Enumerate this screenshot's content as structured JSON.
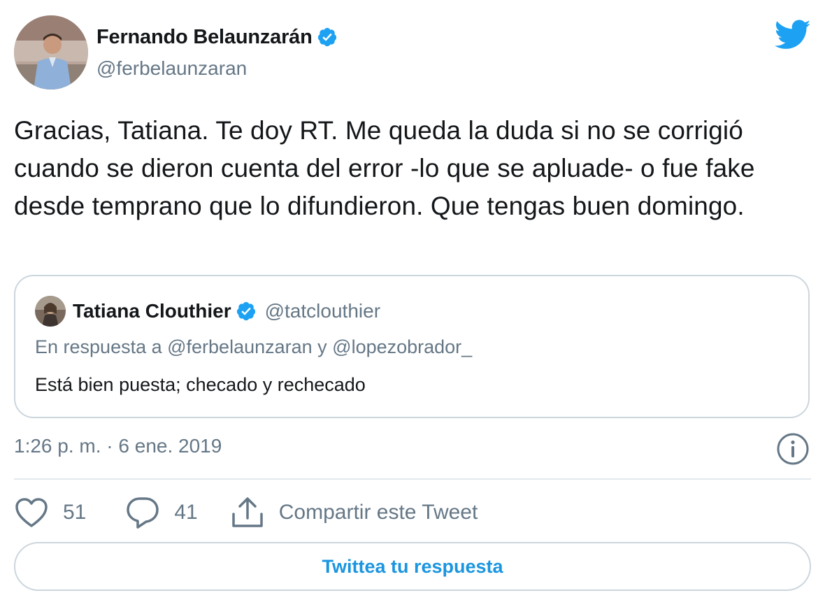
{
  "author": {
    "name": "Fernando Belaunzarán",
    "handle": "@ferbelaunzaran",
    "verified": true
  },
  "tweet": {
    "text": "Gracias, Tatiana. Te doy RT. Me queda la duda si no se corrigió cuando se dieron cuenta del error -lo que se apluade- o fue fake desde temprano que lo difundieron. Que tengas buen domingo.",
    "timestamp": "1:26 p. m. · 6 ene. 2019"
  },
  "quoted_tweet": {
    "name": "Tatiana Clouthier",
    "handle": "@tatclouthier",
    "verified": true,
    "reply_context": "En respuesta a @ferbelaunzaran y @lopezobrador_",
    "text": "Está bien puesta; checado y rechecado"
  },
  "actions": {
    "likes": "51",
    "replies": "41",
    "share_label": "Compartir este Tweet"
  },
  "reply_button_label": "Twittea tu respuesta",
  "icons": {
    "brand": "twitter-bird-icon",
    "verified": "verified-badge-icon",
    "info": "info-icon",
    "like": "heart-icon",
    "reply": "reply-bubble-icon",
    "share": "share-icon"
  },
  "colors": {
    "brand_blue": "#1da1f2",
    "link_blue": "#1b95e0",
    "secondary_text": "#657786",
    "primary_text": "#14171a",
    "border": "#ccd6dd"
  }
}
